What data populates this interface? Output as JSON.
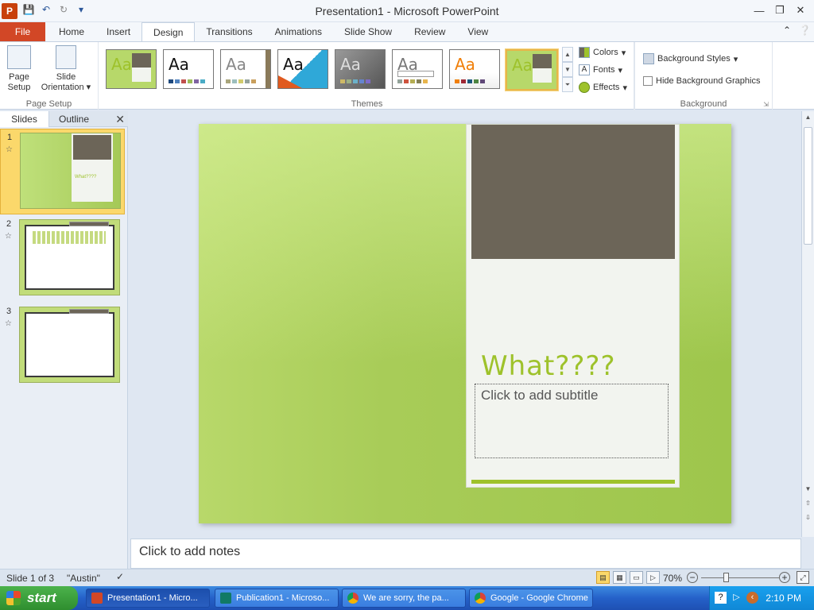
{
  "window": {
    "title": "Presentation1 - Microsoft PowerPoint",
    "app_icon_letter": "P"
  },
  "ribbon_tabs": {
    "file": "File",
    "items": [
      "Home",
      "Insert",
      "Design",
      "Transitions",
      "Animations",
      "Slide Show",
      "Review",
      "View"
    ],
    "active": "Design"
  },
  "page_setup": {
    "page_setup_label": "Page\nSetup",
    "page_setup_line1": "Page",
    "page_setup_line2": "Setup",
    "orientation_line1": "Slide",
    "orientation_line2": "Orientation",
    "group_label": "Page Setup"
  },
  "themes": {
    "group_label": "Themes",
    "aa_label": "Aa"
  },
  "theme_options": {
    "colors": "Colors",
    "fonts": "Fonts",
    "effects": "Effects"
  },
  "background": {
    "styles": "Background Styles",
    "hide_graphics": "Hide Background Graphics",
    "group_label": "Background"
  },
  "left_panel": {
    "tabs": [
      "Slides",
      "Outline"
    ],
    "thumbnails": [
      {
        "number": "1",
        "thumb_text": "What????"
      },
      {
        "number": "2",
        "thumb_text": ""
      },
      {
        "number": "3",
        "thumb_text": ""
      }
    ]
  },
  "slide": {
    "title": "What????",
    "subtitle_placeholder": "Click to add subtitle",
    "colors": {
      "card": "#f2f4ef",
      "brown": "#6c6558",
      "accent": "#9ec22b"
    }
  },
  "notes": {
    "placeholder": "Click to add notes"
  },
  "status": {
    "slide_info": "Slide 1 of 3",
    "theme_name": "\"Austin\"",
    "zoom": "70%",
    "zoom_fraction": 0.35
  },
  "taskbar": {
    "start": "start",
    "buttons": [
      {
        "label": "Presentation1 - Micro...",
        "color": "#d24726"
      },
      {
        "label": "Publication1 - Microso...",
        "color": "#117a65"
      },
      {
        "label": "We are sorry, the pa...",
        "color": "#e3b23c"
      },
      {
        "label": "Google - Google Chrome",
        "color": "#e3b23c"
      }
    ],
    "clock": "2:10 PM"
  }
}
